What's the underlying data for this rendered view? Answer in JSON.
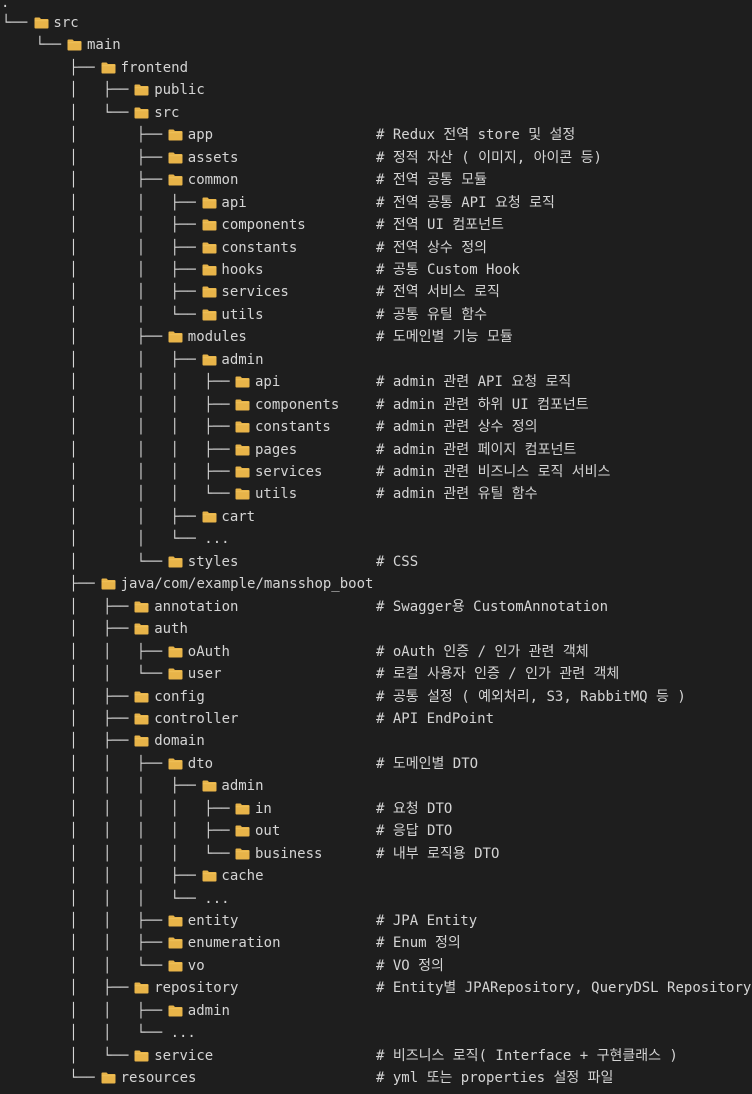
{
  "root_marker": ".",
  "rows": [
    {
      "prefix": "└── ",
      "name": "src",
      "comment": ""
    },
    {
      "prefix": "    └── ",
      "name": "main",
      "comment": ""
    },
    {
      "prefix": "        ├── ",
      "name": "frontend",
      "comment": ""
    },
    {
      "prefix": "        │   ├── ",
      "name": "public",
      "comment": ""
    },
    {
      "prefix": "        │   └── ",
      "name": "src",
      "comment": ""
    },
    {
      "prefix": "        │       ├── ",
      "name": "app",
      "comment": "# Redux 전역 store 및 설정"
    },
    {
      "prefix": "        │       ├── ",
      "name": "assets",
      "comment": "# 정적 자산 ( 이미지, 아이콘 등)"
    },
    {
      "prefix": "        │       ├── ",
      "name": "common",
      "comment": "# 전역 공통 모듈"
    },
    {
      "prefix": "        │       │   ├── ",
      "name": "api",
      "comment": "# 전역 공통 API 요청 로직"
    },
    {
      "prefix": "        │       │   ├── ",
      "name": "components",
      "comment": "# 전역 UI 컴포넌트"
    },
    {
      "prefix": "        │       │   ├── ",
      "name": "constants",
      "comment": "# 전역 상수 정의"
    },
    {
      "prefix": "        │       │   ├── ",
      "name": "hooks",
      "comment": "# 공통 Custom Hook"
    },
    {
      "prefix": "        │       │   ├── ",
      "name": "services",
      "comment": "# 전역 서비스 로직"
    },
    {
      "prefix": "        │       │   └── ",
      "name": "utils",
      "comment": "# 공통 유틸 함수"
    },
    {
      "prefix": "        │       ├── ",
      "name": "modules",
      "comment": "# 도메인별 기능 모듈"
    },
    {
      "prefix": "        │       │   ├── ",
      "name": "admin",
      "comment": ""
    },
    {
      "prefix": "        │       │   │   ├── ",
      "name": "api",
      "comment": "# admin 관련 API 요청 로직"
    },
    {
      "prefix": "        │       │   │   ├── ",
      "name": "components",
      "comment": "# admin 관련 하위 UI 컴포넌트"
    },
    {
      "prefix": "        │       │   │   ├── ",
      "name": "constants",
      "comment": "# admin 관련 상수 정의"
    },
    {
      "prefix": "        │       │   │   ├── ",
      "name": "pages",
      "comment": "# admin 관련 페이지 컴포넌트"
    },
    {
      "prefix": "        │       │   │   ├── ",
      "name": "services",
      "comment": "# admin 관련 비즈니스 로직 서비스"
    },
    {
      "prefix": "        │       │   │   └── ",
      "name": "utils",
      "comment": "# admin 관련 유틸 함수"
    },
    {
      "prefix": "        │       │   ├── ",
      "name": "cart",
      "comment": ""
    },
    {
      "prefix": "        │       │   └── ...",
      "name": "",
      "comment": ""
    },
    {
      "prefix": "        │       └── ",
      "name": "styles",
      "comment": "# CSS"
    },
    {
      "prefix": "        ├── ",
      "name": "java/com/example/mansshop_boot",
      "comment": ""
    },
    {
      "prefix": "        │   ├── ",
      "name": "annotation",
      "comment": "# Swagger용 CustomAnnotation"
    },
    {
      "prefix": "        │   ├── ",
      "name": "auth",
      "comment": ""
    },
    {
      "prefix": "        │   │   ├── ",
      "name": "oAuth",
      "comment": "# oAuth 인증 / 인가 관련 객체"
    },
    {
      "prefix": "        │   │   └── ",
      "name": "user",
      "comment": "# 로컬 사용자 인증 / 인가 관련 객체"
    },
    {
      "prefix": "        │   ├── ",
      "name": "config",
      "comment": "# 공통 설정 ( 예외처리, S3, RabbitMQ 등 )"
    },
    {
      "prefix": "        │   ├── ",
      "name": "controller",
      "comment": "# API EndPoint"
    },
    {
      "prefix": "        │   ├── ",
      "name": "domain",
      "comment": ""
    },
    {
      "prefix": "        │   │   ├── ",
      "name": "dto",
      "comment": "# 도메인별 DTO"
    },
    {
      "prefix": "        │   │   │   ├── ",
      "name": "admin",
      "comment": ""
    },
    {
      "prefix": "        │   │   │   │   ├── ",
      "name": "in",
      "comment": "# 요청 DTO"
    },
    {
      "prefix": "        │   │   │   │   ├── ",
      "name": "out",
      "comment": "# 응답 DTO"
    },
    {
      "prefix": "        │   │   │   │   └── ",
      "name": "business",
      "comment": "# 내부 로직용 DTO"
    },
    {
      "prefix": "        │   │   │   ├── ",
      "name": "cache",
      "comment": ""
    },
    {
      "prefix": "        │   │   │   └── ...",
      "name": "",
      "comment": ""
    },
    {
      "prefix": "        │   │   ├── ",
      "name": "entity",
      "comment": "# JPA Entity"
    },
    {
      "prefix": "        │   │   ├── ",
      "name": "enumeration",
      "comment": "# Enum 정의"
    },
    {
      "prefix": "        │   │   └── ",
      "name": "vo",
      "comment": "# VO 정의"
    },
    {
      "prefix": "        │   ├── ",
      "name": "repository",
      "comment": "# Entity별 JPARepository, QueryDSL Repository"
    },
    {
      "prefix": "        │   │   ├── ",
      "name": "admin",
      "comment": ""
    },
    {
      "prefix": "        │   │   └── ...",
      "name": "",
      "comment": ""
    },
    {
      "prefix": "        │   └── ",
      "name": "service",
      "comment": "# 비즈니스 로직( Interface + 구현클래스 )"
    },
    {
      "prefix": "        └── ",
      "name": "resources",
      "comment": "# yml 또는 properties 설정 파일"
    }
  ],
  "colors": {
    "background": "#1e1e1e",
    "text": "#d4d4d4",
    "folder": "#e8b449",
    "folder_tab": "#f3c862"
  },
  "icon": "folder-icon"
}
